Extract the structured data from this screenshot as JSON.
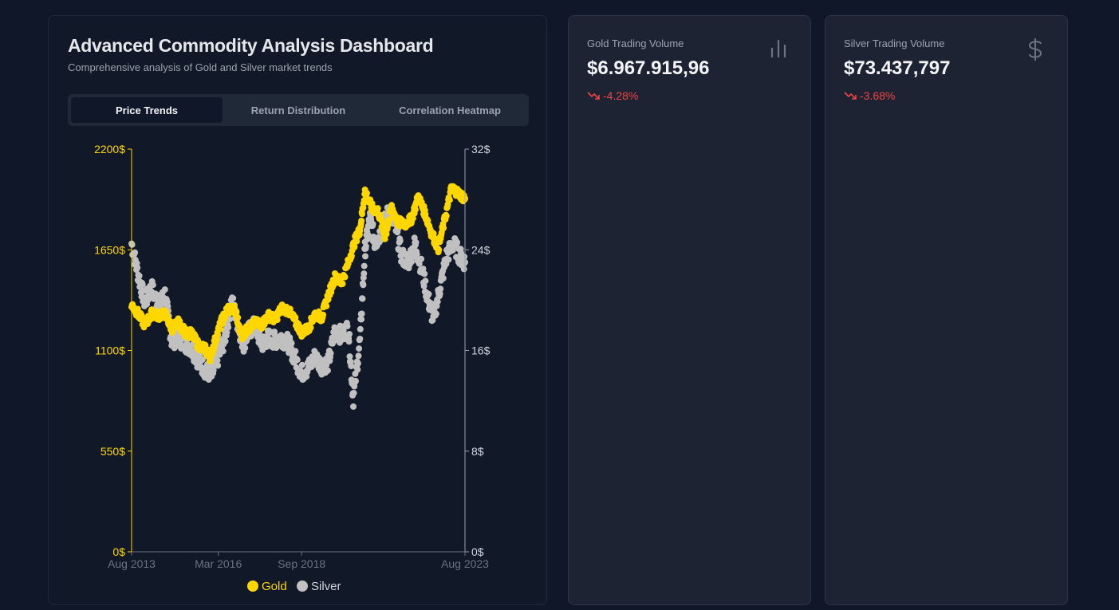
{
  "dashboard": {
    "title": "Advanced Commodity Analysis Dashboard",
    "subtitle": "Comprehensive analysis of Gold and Silver market trends",
    "tabs": [
      {
        "label": "Price Trends",
        "active": true
      },
      {
        "label": "Return Distribution",
        "active": false
      },
      {
        "label": "Correlation Heatmap",
        "active": false
      }
    ]
  },
  "cards": [
    {
      "label": "Gold Trading Volume",
      "value": "$6.967.915,96",
      "change": "-4.28%",
      "icon": "bar-chart-icon"
    },
    {
      "label": "Silver Trading Volume",
      "value": "$73.437,797",
      "change": "-3.68%",
      "icon": "dollar-icon"
    }
  ],
  "colors": {
    "gold": "#FFD700",
    "silver": "#C0C0C0",
    "negative": "#ef4444"
  },
  "chart_data": {
    "type": "scatter",
    "x_ticks": [
      "Aug 2013",
      "Mar 2016",
      "Sep 2018",
      "Aug 2023"
    ],
    "y_left_ticks": [
      "0$",
      "550$",
      "1100$",
      "1650$",
      "2200$"
    ],
    "y_right_ticks": [
      "0$",
      "8$",
      "16$",
      "24$",
      "32$"
    ],
    "ylim_left": [
      0,
      2200
    ],
    "ylim_right": [
      0,
      32
    ],
    "xlim": [
      2013.6,
      2023.6
    ],
    "legend": "bottom",
    "series": [
      {
        "name": "Gold",
        "axis": "left",
        "color": "#FFD700",
        "points": [
          [
            2013.6,
            1350
          ],
          [
            2013.8,
            1300
          ],
          [
            2014.0,
            1240
          ],
          [
            2014.2,
            1300
          ],
          [
            2014.4,
            1290
          ],
          [
            2014.6,
            1300
          ],
          [
            2014.8,
            1220
          ],
          [
            2015.0,
            1250
          ],
          [
            2015.2,
            1200
          ],
          [
            2015.4,
            1190
          ],
          [
            2015.6,
            1130
          ],
          [
            2015.8,
            1110
          ],
          [
            2015.95,
            1060
          ],
          [
            2016.1,
            1150
          ],
          [
            2016.3,
            1260
          ],
          [
            2016.5,
            1330
          ],
          [
            2016.7,
            1320
          ],
          [
            2016.9,
            1180
          ],
          [
            2017.1,
            1220
          ],
          [
            2017.3,
            1250
          ],
          [
            2017.5,
            1240
          ],
          [
            2017.7,
            1290
          ],
          [
            2017.9,
            1270
          ],
          [
            2018.1,
            1330
          ],
          [
            2018.3,
            1320
          ],
          [
            2018.5,
            1260
          ],
          [
            2018.7,
            1200
          ],
          [
            2018.9,
            1220
          ],
          [
            2019.1,
            1300
          ],
          [
            2019.3,
            1280
          ],
          [
            2019.5,
            1400
          ],
          [
            2019.7,
            1500
          ],
          [
            2019.9,
            1470
          ],
          [
            2020.1,
            1580
          ],
          [
            2020.3,
            1700
          ],
          [
            2020.45,
            1760
          ],
          [
            2020.6,
            1970
          ],
          [
            2020.8,
            1880
          ],
          [
            2021.0,
            1860
          ],
          [
            2021.2,
            1720
          ],
          [
            2021.4,
            1880
          ],
          [
            2021.6,
            1800
          ],
          [
            2021.8,
            1790
          ],
          [
            2022.0,
            1820
          ],
          [
            2022.2,
            1940
          ],
          [
            2022.4,
            1850
          ],
          [
            2022.6,
            1740
          ],
          [
            2022.8,
            1660
          ],
          [
            2023.0,
            1820
          ],
          [
            2023.2,
            1990
          ],
          [
            2023.4,
            1960
          ],
          [
            2023.6,
            1930
          ]
        ]
      },
      {
        "name": "Silver",
        "axis": "right",
        "color": "#C0C0C0",
        "points": [
          [
            2013.6,
            24.5
          ],
          [
            2013.8,
            22.0
          ],
          [
            2014.0,
            19.8
          ],
          [
            2014.2,
            21.0
          ],
          [
            2014.4,
            19.5
          ],
          [
            2014.6,
            20.5
          ],
          [
            2014.8,
            16.8
          ],
          [
            2015.0,
            17.0
          ],
          [
            2015.2,
            16.6
          ],
          [
            2015.4,
            16.2
          ],
          [
            2015.6,
            15.2
          ],
          [
            2015.8,
            14.5
          ],
          [
            2016.0,
            14.0
          ],
          [
            2016.2,
            15.5
          ],
          [
            2016.4,
            17.0
          ],
          [
            2016.6,
            20.0
          ],
          [
            2016.8,
            18.0
          ],
          [
            2016.95,
            16.5
          ],
          [
            2017.1,
            17.5
          ],
          [
            2017.3,
            18.0
          ],
          [
            2017.5,
            16.5
          ],
          [
            2017.7,
            17.0
          ],
          [
            2017.9,
            16.8
          ],
          [
            2018.1,
            17.0
          ],
          [
            2018.3,
            16.6
          ],
          [
            2018.5,
            15.4
          ],
          [
            2018.7,
            14.2
          ],
          [
            2018.9,
            14.6
          ],
          [
            2019.1,
            15.5
          ],
          [
            2019.3,
            14.8
          ],
          [
            2019.5,
            15.0
          ],
          [
            2019.7,
            17.6
          ],
          [
            2019.9,
            17.2
          ],
          [
            2020.1,
            17.8
          ],
          [
            2020.25,
            12.2
          ],
          [
            2020.45,
            16.8
          ],
          [
            2020.6,
            24.0
          ],
          [
            2020.75,
            26.5
          ],
          [
            2020.9,
            24.5
          ],
          [
            2021.1,
            25.5
          ],
          [
            2021.3,
            27.0
          ],
          [
            2021.5,
            26.0
          ],
          [
            2021.7,
            23.5
          ],
          [
            2021.9,
            23.0
          ],
          [
            2022.1,
            24.5
          ],
          [
            2022.3,
            22.5
          ],
          [
            2022.5,
            20.0
          ],
          [
            2022.65,
            18.5
          ],
          [
            2022.85,
            21.0
          ],
          [
            2023.05,
            23.5
          ],
          [
            2023.25,
            24.5
          ],
          [
            2023.45,
            23.5
          ],
          [
            2023.6,
            23.0
          ]
        ]
      }
    ]
  }
}
